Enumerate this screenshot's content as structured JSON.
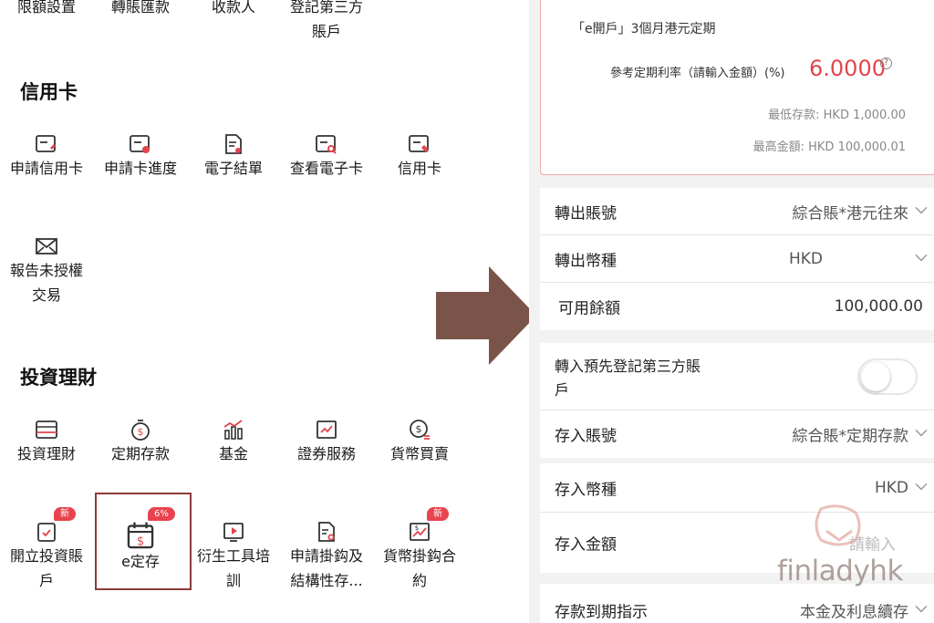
{
  "left": {
    "top_row": [
      "限額設置",
      "轉賬匯款",
      "收款人",
      "登記第三方",
      "賬戶"
    ],
    "credit_section": {
      "title": "信用卡"
    },
    "credit_items": [
      "申請信用卡",
      "申請卡進度",
      "電子結單",
      "查看電子卡",
      "信用卡"
    ],
    "report_item": {
      "line1": "報告未授權",
      "line2": "交易"
    },
    "invest_section": {
      "title": "投資理財"
    },
    "invest_items": [
      "投資理財",
      "定期存款",
      "基金",
      "證券服務",
      "貨幣買賣"
    ],
    "invest_items_row2": [
      {
        "line1": "開立投資賬",
        "line2": "戶",
        "badge": "新"
      },
      {
        "line1": "e定存",
        "line2": "",
        "badge": "6%"
      },
      {
        "line1": "衍生工具培",
        "line2": "訓"
      },
      {
        "line1": "申請掛鈎及",
        "line2": "結構性存..."
      },
      {
        "line1": "貨幣掛鈎合",
        "line2": "約",
        "badge": "新"
      }
    ]
  },
  "right": {
    "rate_card": {
      "title": "「e開戶」3個月港元定期",
      "rate_label": "參考定期利率（請輸入金額）(%)",
      "rate_value": "6.0000",
      "help": "?",
      "min_deposit": "最低存款: HKD 1,000.00",
      "max_amount": "最高金額: HKD 100,000.01"
    },
    "group1": [
      {
        "label": "轉出賬號",
        "value": "綜合賬*港元往來"
      },
      {
        "label": "轉出幣種",
        "value": "HKD"
      },
      {
        "label": "可用餘額",
        "value": "100,000.00"
      }
    ],
    "group2": {
      "toggle_label_line1": "轉入預先登記第三方賬",
      "toggle_label_line2": "戶",
      "deposit_account_label": "存入賬號",
      "deposit_account_value": "綜合賬*定期存款",
      "deposit_currency_label": "存入幣種",
      "deposit_currency_value": "HKD",
      "deposit_amount_label": "存入金額",
      "deposit_amount_placeholder": "請輸入",
      "maturity_label": "存款到期指示",
      "maturity_value": "本金及利息續存"
    }
  },
  "watermark": "finladyhk",
  "colors": {
    "accent_red": "#e2454d",
    "arrow": "#7a5349",
    "highlight_border": "#8b3b3b"
  }
}
